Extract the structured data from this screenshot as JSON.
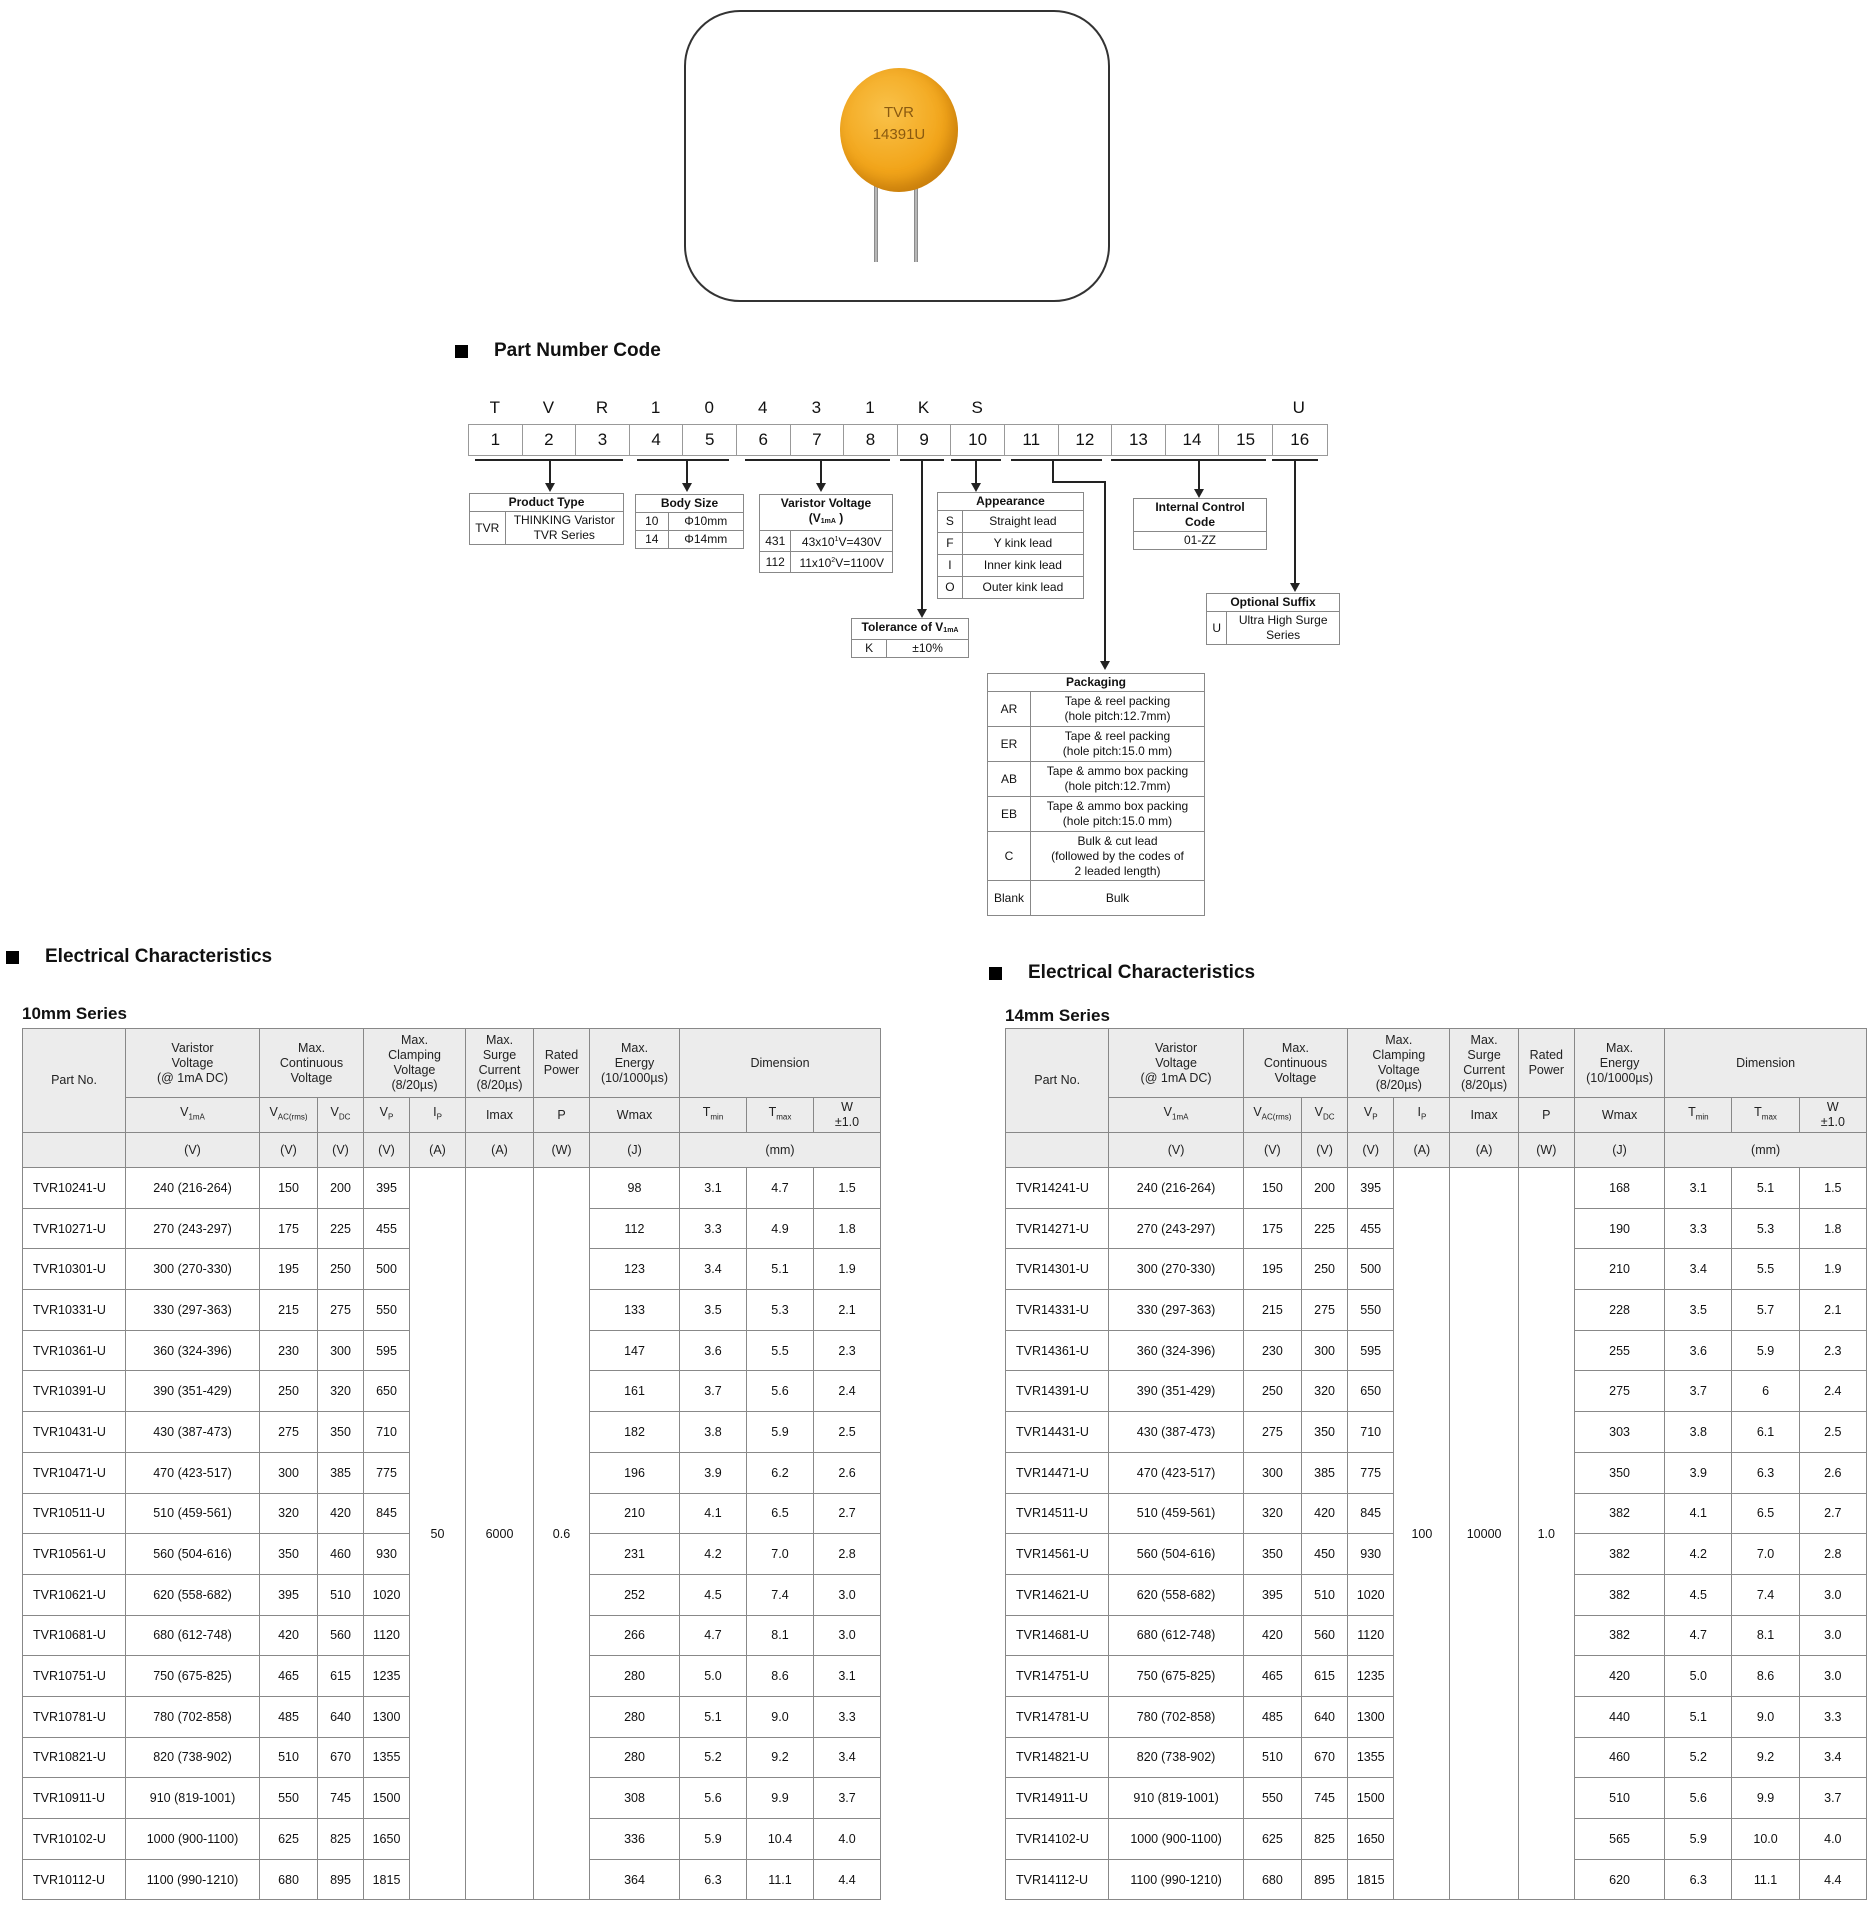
{
  "product_image": {
    "marking_line1": "TVR",
    "marking_line2": "14391U",
    "body_color": "#f2a51a"
  },
  "part_number_code": {
    "title": "Part Number Code",
    "letters": [
      "T",
      "V",
      "R",
      "1",
      "0",
      "4",
      "3",
      "1",
      "K",
      "S",
      "",
      "",
      "",
      "",
      "",
      "U"
    ],
    "positions": [
      "1",
      "2",
      "3",
      "4",
      "5",
      "6",
      "7",
      "8",
      "9",
      "10",
      "11",
      "12",
      "13",
      "14",
      "15",
      "16"
    ],
    "product_type": {
      "title": "Product Type",
      "rows": [
        {
          "code": "TVR",
          "desc_line1": "THINKING Varistor",
          "desc_line2": "TVR Series"
        }
      ]
    },
    "body_size": {
      "title": "Body Size",
      "rows": [
        {
          "code": "10",
          "desc": "Φ10mm"
        },
        {
          "code": "14",
          "desc": "Φ14mm"
        }
      ]
    },
    "varistor_voltage": {
      "title": "Varistor Voltage",
      "title_sym": "V",
      "title_sub": "1mA",
      "rows": [
        {
          "code": "431",
          "mant": "43x10",
          "exp": "1",
          "rest": "V=430V"
        },
        {
          "code": "112",
          "mant": "11x10",
          "exp": "2",
          "rest": "V=1100V"
        }
      ]
    },
    "tolerance": {
      "title": "Tolerance of V",
      "title_sub": "1mA",
      "rows": [
        {
          "code": "K",
          "desc": "±10%"
        }
      ]
    },
    "appearance": {
      "title": "Appearance",
      "rows": [
        {
          "code": "S",
          "desc": "Straight lead"
        },
        {
          "code": "F",
          "desc": "Y kink lead"
        },
        {
          "code": "I",
          "desc": "Inner kink lead"
        },
        {
          "code": "O",
          "desc": "Outer kink lead"
        }
      ]
    },
    "internal_control": {
      "title_line1": "Internal Control",
      "title_line2": "Code",
      "value": "01-ZZ"
    },
    "optional_suffix": {
      "title": "Optional Suffix",
      "rows": [
        {
          "code": "U",
          "desc_line1": "Ultra High Surge",
          "desc_line2": "Series"
        }
      ]
    },
    "packaging": {
      "title": "Packaging",
      "rows": [
        {
          "code": "AR",
          "l1": "Tape & reel packing",
          "l2": "(hole pitch:12.7mm)",
          "l3": ""
        },
        {
          "code": "ER",
          "l1": "Tape & reel packing",
          "l2": "(hole pitch:15.0 mm)",
          "l3": ""
        },
        {
          "code": "AB",
          "l1": "Tape & ammo box packing",
          "l2": "(hole pitch:12.7mm)",
          "l3": ""
        },
        {
          "code": "EB",
          "l1": "Tape & ammo box packing",
          "l2": "(hole pitch:15.0 mm)",
          "l3": ""
        },
        {
          "code": "C",
          "l1": "Bulk & cut lead",
          "l2": "(followed by the codes of",
          "l3": "2 leaded length)"
        },
        {
          "code": "Blank",
          "l1": "Bulk",
          "l2": "",
          "l3": ""
        }
      ]
    }
  },
  "electrical": {
    "section_title": "Electrical Characteristics",
    "header": {
      "part_no": "Part No.",
      "varistor_voltage": [
        "Varistor",
        "Voltage",
        "(@ 1mA DC)"
      ],
      "max_continuous": [
        "Max.",
        "Continuous",
        "Voltage"
      ],
      "max_clamping": [
        "Max.",
        "Clamping",
        "Voltage",
        "(8/20µs)"
      ],
      "max_surge": [
        "Max.",
        "Surge",
        "Current",
        "(8/20µs)"
      ],
      "rated_power": [
        "Rated",
        "Power"
      ],
      "max_energy": [
        "Max.",
        "Energy",
        "(10/1000µs)"
      ],
      "dimension": "Dimension",
      "sym_v1ma": "V",
      "sym_v1ma_sub": "1mA",
      "sym_vac": "V",
      "sym_vac_sub": "AC(rms)",
      "sym_vdc": "V",
      "sym_vdc_sub": "DC",
      "sym_vp": "V",
      "sym_vp_sub": "P",
      "sym_ip": "I",
      "sym_ip_sub": "P",
      "sym_imax": "Imax",
      "sym_p": "P",
      "sym_wmax": "Wmax",
      "sym_tmin": "T",
      "sym_tmin_sub": "min",
      "sym_tmax": "T",
      "sym_tmax_sub": "max",
      "sym_w": [
        "W",
        "±1.0"
      ],
      "unit_v": "(V)",
      "unit_a": "(A)",
      "unit_w": "(W)",
      "unit_j": "(J)",
      "unit_mm": "(mm)"
    },
    "tables": [
      {
        "series_title": "10mm Series",
        "ip": "50",
        "imax": "6000",
        "p": "0.6",
        "rows": [
          [
            "TVR10241-U",
            "240 (216-264)",
            "150",
            "200",
            "395",
            "98",
            "3.1",
            "4.7",
            "1.5"
          ],
          [
            "TVR10271-U",
            "270 (243-297)",
            "175",
            "225",
            "455",
            "112",
            "3.3",
            "4.9",
            "1.8"
          ],
          [
            "TVR10301-U",
            "300 (270-330)",
            "195",
            "250",
            "500",
            "123",
            "3.4",
            "5.1",
            "1.9"
          ],
          [
            "TVR10331-U",
            "330 (297-363)",
            "215",
            "275",
            "550",
            "133",
            "3.5",
            "5.3",
            "2.1"
          ],
          [
            "TVR10361-U",
            "360 (324-396)",
            "230",
            "300",
            "595",
            "147",
            "3.6",
            "5.5",
            "2.3"
          ],
          [
            "TVR10391-U",
            "390 (351-429)",
            "250",
            "320",
            "650",
            "161",
            "3.7",
            "5.6",
            "2.4"
          ],
          [
            "TVR10431-U",
            "430 (387-473)",
            "275",
            "350",
            "710",
            "182",
            "3.8",
            "5.9",
            "2.5"
          ],
          [
            "TVR10471-U",
            "470 (423-517)",
            "300",
            "385",
            "775",
            "196",
            "3.9",
            "6.2",
            "2.6"
          ],
          [
            "TVR10511-U",
            "510 (459-561)",
            "320",
            "420",
            "845",
            "210",
            "4.1",
            "6.5",
            "2.7"
          ],
          [
            "TVR10561-U",
            "560 (504-616)",
            "350",
            "460",
            "930",
            "231",
            "4.2",
            "7.0",
            "2.8"
          ],
          [
            "TVR10621-U",
            "620 (558-682)",
            "395",
            "510",
            "1020",
            "252",
            "4.5",
            "7.4",
            "3.0"
          ],
          [
            "TVR10681-U",
            "680 (612-748)",
            "420",
            "560",
            "1120",
            "266",
            "4.7",
            "8.1",
            "3.0"
          ],
          [
            "TVR10751-U",
            "750 (675-825)",
            "465",
            "615",
            "1235",
            "280",
            "5.0",
            "8.6",
            "3.1"
          ],
          [
            "TVR10781-U",
            "780 (702-858)",
            "485",
            "640",
            "1300",
            "280",
            "5.1",
            "9.0",
            "3.3"
          ],
          [
            "TVR10821-U",
            "820 (738-902)",
            "510",
            "670",
            "1355",
            "280",
            "5.2",
            "9.2",
            "3.4"
          ],
          [
            "TVR10911-U",
            "910 (819-1001)",
            "550",
            "745",
            "1500",
            "308",
            "5.6",
            "9.9",
            "3.7"
          ],
          [
            "TVR10102-U",
            "1000 (900-1100)",
            "625",
            "825",
            "1650",
            "336",
            "5.9",
            "10.4",
            "4.0"
          ],
          [
            "TVR10112-U",
            "1100 (990-1210)",
            "680",
            "895",
            "1815",
            "364",
            "6.3",
            "11.1",
            "4.4"
          ]
        ]
      },
      {
        "series_title": "14mm Series",
        "ip": "100",
        "imax": "10000",
        "p": "1.0",
        "rows": [
          [
            "TVR14241-U",
            "240 (216-264)",
            "150",
            "200",
            "395",
            "168",
            "3.1",
            "5.1",
            "1.5"
          ],
          [
            "TVR14271-U",
            "270 (243-297)",
            "175",
            "225",
            "455",
            "190",
            "3.3",
            "5.3",
            "1.8"
          ],
          [
            "TVR14301-U",
            "300 (270-330)",
            "195",
            "250",
            "500",
            "210",
            "3.4",
            "5.5",
            "1.9"
          ],
          [
            "TVR14331-U",
            "330 (297-363)",
            "215",
            "275",
            "550",
            "228",
            "3.5",
            "5.7",
            "2.1"
          ],
          [
            "TVR14361-U",
            "360 (324-396)",
            "230",
            "300",
            "595",
            "255",
            "3.6",
            "5.9",
            "2.3"
          ],
          [
            "TVR14391-U",
            "390 (351-429)",
            "250",
            "320",
            "650",
            "275",
            "3.7",
            "6",
            "2.4"
          ],
          [
            "TVR14431-U",
            "430 (387-473)",
            "275",
            "350",
            "710",
            "303",
            "3.8",
            "6.1",
            "2.5"
          ],
          [
            "TVR14471-U",
            "470 (423-517)",
            "300",
            "385",
            "775",
            "350",
            "3.9",
            "6.3",
            "2.6"
          ],
          [
            "TVR14511-U",
            "510 (459-561)",
            "320",
            "420",
            "845",
            "382",
            "4.1",
            "6.5",
            "2.7"
          ],
          [
            "TVR14561-U",
            "560 (504-616)",
            "350",
            "450",
            "930",
            "382",
            "4.2",
            "7.0",
            "2.8"
          ],
          [
            "TVR14621-U",
            "620 (558-682)",
            "395",
            "510",
            "1020",
            "382",
            "4.5",
            "7.4",
            "3.0"
          ],
          [
            "TVR14681-U",
            "680 (612-748)",
            "420",
            "560",
            "1120",
            "382",
            "4.7",
            "8.1",
            "3.0"
          ],
          [
            "TVR14751-U",
            "750 (675-825)",
            "465",
            "615",
            "1235",
            "420",
            "5.0",
            "8.6",
            "3.0"
          ],
          [
            "TVR14781-U",
            "780 (702-858)",
            "485",
            "640",
            "1300",
            "440",
            "5.1",
            "9.0",
            "3.3"
          ],
          [
            "TVR14821-U",
            "820 (738-902)",
            "510",
            "670",
            "1355",
            "460",
            "5.2",
            "9.2",
            "3.4"
          ],
          [
            "TVR14911-U",
            "910 (819-1001)",
            "550",
            "745",
            "1500",
            "510",
            "5.6",
            "9.9",
            "3.7"
          ],
          [
            "TVR14102-U",
            "1000 (900-1100)",
            "625",
            "825",
            "1650",
            "565",
            "5.9",
            "10.0",
            "4.0"
          ],
          [
            "TVR14112-U",
            "1100 (990-1210)",
            "680",
            "895",
            "1815",
            "620",
            "6.3",
            "11.1",
            "4.4"
          ]
        ]
      }
    ]
  }
}
